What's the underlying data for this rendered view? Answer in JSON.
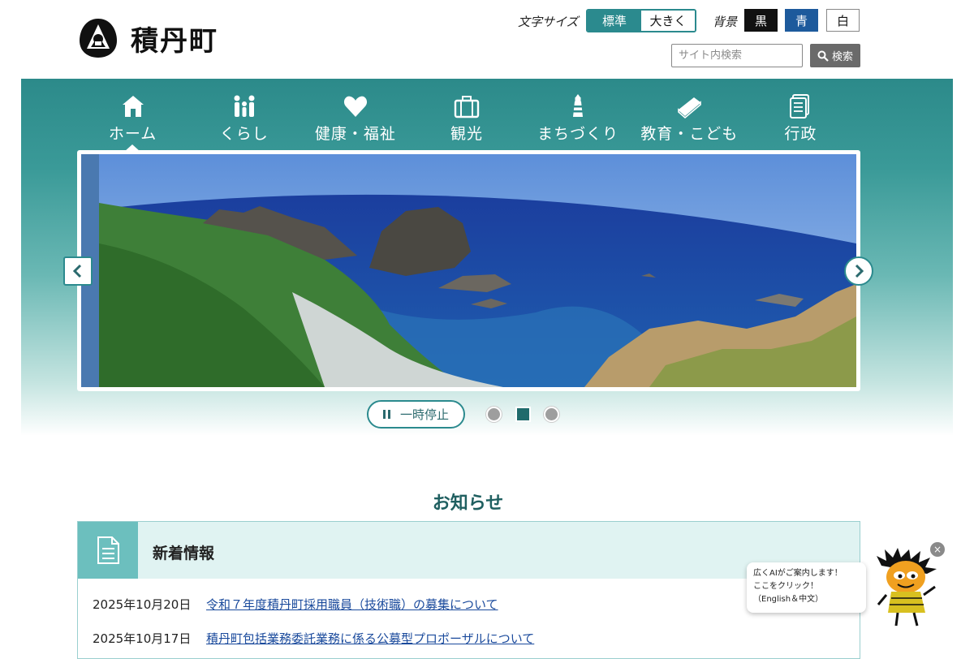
{
  "header": {
    "logo_text": "積丹町",
    "font_size_label": "文字サイズ",
    "font_size_options": [
      "標準",
      "大きく"
    ],
    "background_label": "背景",
    "background_options": [
      "黒",
      "青",
      "白"
    ],
    "search": {
      "placeholder": "サイト内検索",
      "button_label": "検索"
    }
  },
  "nav": {
    "items": [
      {
        "label": "ホーム",
        "icon": "home-icon"
      },
      {
        "label": "くらし",
        "icon": "family-icon"
      },
      {
        "label": "健康・福祉",
        "icon": "heart-icon"
      },
      {
        "label": "観光",
        "icon": "suitcase-icon"
      },
      {
        "label": "まちづくり",
        "icon": "lighthouse-icon"
      },
      {
        "label": "教育・こども",
        "icon": "book-icon"
      },
      {
        "label": "行政",
        "icon": "document-icon"
      }
    ]
  },
  "slider": {
    "pause_label": "一時停止",
    "dot_count": 3,
    "active_dot": 2
  },
  "news": {
    "section_title": "お知らせ",
    "header_label": "新着情報",
    "items": [
      {
        "date": "2025年10月20日",
        "title": "令和７年度積丹町採用職員（技術職）の募集について"
      },
      {
        "date": "2025年10月17日",
        "title": "積丹町包括業務委託業務に係る公募型プロポーザルについて"
      }
    ]
  },
  "ai_assistant": {
    "lines": [
      "広くAIがご案内します！",
      "ここをクリック！",
      "（English＆中文）"
    ],
    "close_label": "×"
  },
  "colors": {
    "accent": "#2b8a8e",
    "link": "#1a4a9c",
    "news_head_bg": "#e0f3f2",
    "news_icon_bg": "#6cbfbe"
  }
}
